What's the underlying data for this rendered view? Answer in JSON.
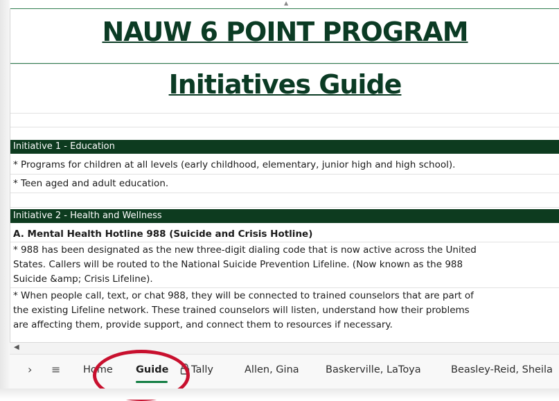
{
  "sheet": {
    "title_line1": "NAUW 6 POINT PROGRAM",
    "title_line2": "Initiatives Guide",
    "initiative1_header": "Initiative 1 - Education",
    "initiative1_items": [
      "* Programs for children at all levels (early childhood, elementary, junior high and high school).",
      "* Teen aged and adult education."
    ],
    "initiative2_header": "Initiative 2 - Health and Wellness",
    "initiative2_sub_a": "A. Mental Health Hotline 988 (Suicide and Crisis Hotline)",
    "para1_lines": [
      "* 988 has been designated as the new three-digit dialing code that is now active across the United",
      "States. Callers will be routed to the National Suicide Prevention Lifeline. (Now known as the 988",
      "Suicide &amp; Crisis Lifeline)."
    ],
    "para2_lines": [
      "* When people call, text, or chat 988, they will be connected to trained counselors that are part of",
      "the existing Lifeline network. These trained counselors will listen, understand how their problems",
      "are affecting them, provide support, and connect them to resources if necessary."
    ]
  },
  "tabs": {
    "chevron": "›",
    "menu": "≡",
    "home": "Home",
    "guide": "Guide",
    "tally": "Tally",
    "allen": "Allen, Gina",
    "baskerville": "Baskerville, LaToya",
    "beasley": "Beasley-Reid, Sheila"
  },
  "colors": {
    "header_band": "#0d3b1f",
    "title_text": "#0b3b24",
    "active_tab_underline": "#107c41",
    "highlight_circle": "#c8102e"
  }
}
